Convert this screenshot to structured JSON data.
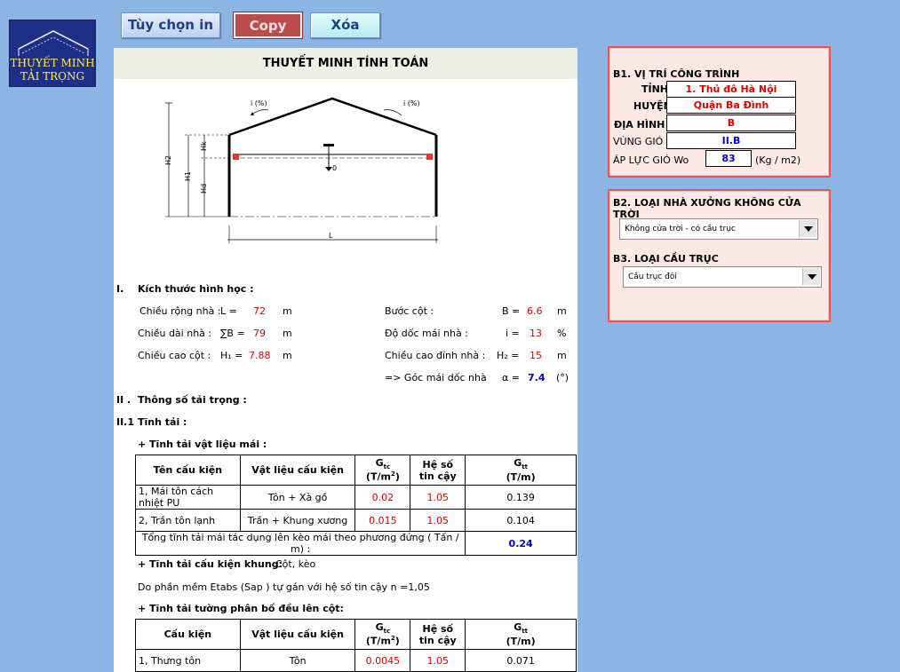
{
  "logo": {
    "line1": "THUYẾT MINH",
    "line2": "TẢI TRỌNG"
  },
  "toolbar": {
    "print_label": "Tùy chọn in",
    "copy_label": "Copy",
    "delete_label": "Xóa"
  },
  "sheet": {
    "title": "THUYẾT MINH TÍNH TOÁN",
    "diagram_labels": {
      "h2": "H2",
      "h1": "H1",
      "hk": "Hk",
      "hd": "Hd",
      "i_left": "i (%)",
      "i_right": "i (%)",
      "span": "L",
      "q": "0"
    },
    "section1": {
      "num": "I.",
      "title": "Kích thước hình học :",
      "width_label": "Chiều rộng nhà :",
      "width_sym": "L =",
      "width_val": "72",
      "width_unit": "m",
      "length_label": "Chiều dài nhà :",
      "length_sym": "∑B =",
      "length_val": "79",
      "length_unit": "m",
      "col_height_label": "Chiều cao cột :",
      "col_height_sym": "H₁ =",
      "col_height_val": "7.88",
      "col_height_unit": "m",
      "step_label": "Bước cột :",
      "step_sym": "B =",
      "step_val": "6.6",
      "step_unit": "m",
      "slope_label": "Độ dốc mái nhà :",
      "slope_sym": "i =",
      "slope_val": "13",
      "slope_unit": "%",
      "ridge_label": "Chiều cao đỉnh nhà :",
      "ridge_sym": "H₂ =",
      "ridge_val": "15",
      "ridge_unit": "m",
      "angle_label": "=> Góc mái dốc nhà",
      "angle_sym": "α =",
      "angle_val": "7.4",
      "angle_unit": "(°)"
    },
    "section2": {
      "num": "II .",
      "title": "Thông số tải trọng :",
      "sub1": "II.1",
      "sub1_title": "Tĩnh tải :",
      "roof_title": "+ Tĩnh tải vật liệu mái :",
      "table1": {
        "headers": [
          "Tên cấu kiện",
          "Vật liệu cấu kiện",
          "Gtc (T/m²)",
          "Hệ số tin cậy",
          "Gtt (T/m)"
        ],
        "rows": [
          [
            "1, Mái tôn cách nhiệt PU",
            "Tôn + Xà gồ",
            "0.02",
            "1.05",
            "0.139"
          ],
          [
            "2, Trần tôn lạnh",
            "Trần + Khung xương",
            "0.015",
            "1.05",
            "0.104"
          ]
        ],
        "total_label": "Tổng tĩnh tải mái tác dụng lên kèo mái theo phương đứng ( Tấn / m) :",
        "total_value": "0.24"
      },
      "frame_title": "+ Tĩnh tải cấu kiện khung:",
      "frame_value": "Cột, kèo",
      "frame_note": "Do phần mềm Etabs (Sap ) tự gán với hệ số tin cậy n =1,05",
      "wall_title": "+ Tĩnh tải tường phân bố đều lên cột:",
      "table2": {
        "headers": [
          "Cấu kiện",
          "Vật liệu cấu kiện",
          "Gtc (T/m²)",
          "Hệ số tin cậy",
          "Gtt (T/m)"
        ],
        "rows": [
          [
            "1, Thưng tôn",
            "Tôn",
            "0.0045",
            "1.05",
            "0.071"
          ]
        ]
      }
    }
  },
  "panel_b1": {
    "title": "B1. VỊ TRÍ CÔNG TRÌNH",
    "province_label": "TỈNH",
    "province_value": "1. Thủ đô Hà Nội",
    "district_label": "HUYỆN",
    "district_value": "Quận Ba Đình",
    "terrain_label": "ĐỊA HÌNH",
    "terrain_value": "B",
    "wind_zone_label": "VÙNG GIÓ",
    "wind_zone_value": "II.B",
    "wind_pressure_label": "ÁP LỰC GIÓ Wo",
    "wind_pressure_value": "83",
    "wind_pressure_unit": "(Kg / m2)"
  },
  "panel_b2": {
    "title": "B2. LOẠI NHÀ XƯỞNG KHÔNG CỬA TRỜI",
    "selected": "Không cửa trời - có cầu trục",
    "b3_title": "B3. LOẠI CẦU TRỤC",
    "b3_selected": "Cầu trục đôi"
  }
}
